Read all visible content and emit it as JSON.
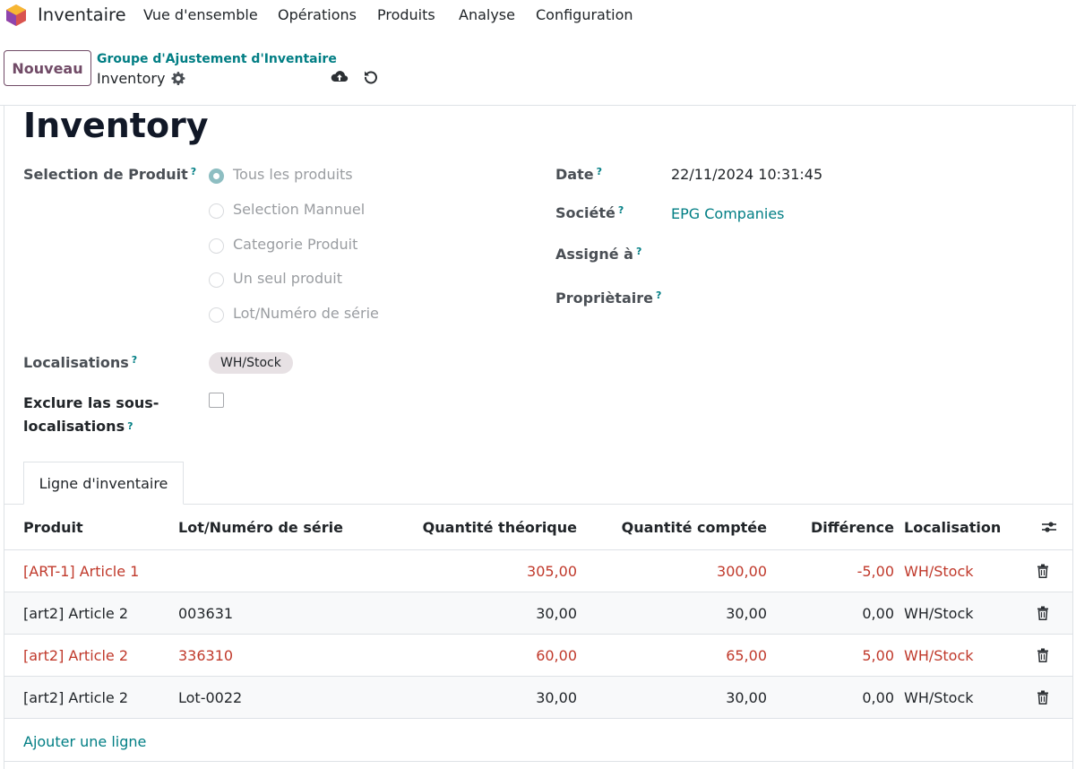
{
  "nav": {
    "app_name": "Inventaire",
    "menu": [
      "Vue d'ensemble",
      "Opérations",
      "Produits",
      "Analyse",
      "Configuration"
    ]
  },
  "control": {
    "new_button": "Nouveau",
    "breadcrumb_parent": "Groupe d'Ajustement d'Inventaire",
    "breadcrumb_current": "Inventory"
  },
  "form": {
    "title": "Inventory",
    "product_selection": {
      "label": "Selection de Produit",
      "help": "?",
      "options": [
        "Tous les produits",
        "Selection Mannuel",
        "Categorie Produit",
        "Un seul produit",
        "Lot/Numéro de série"
      ],
      "selected": "Tous les produits"
    },
    "date": {
      "label": "Date",
      "help": "?",
      "value": "22/11/2024 10:31:45"
    },
    "company": {
      "label": "Société",
      "help": "?",
      "value": "EPG Companies"
    },
    "assigned": {
      "label": "Assigné à",
      "help": "?",
      "value": ""
    },
    "owner": {
      "label": "Propriètaire",
      "help": "?",
      "value": ""
    },
    "locations": {
      "label": "Localisations",
      "help": "?",
      "tag": "WH/Stock"
    },
    "exclude": {
      "label_line1": "Exclure las sous-",
      "label_line2": "localisations",
      "help": "?",
      "checked": false
    }
  },
  "tabs": {
    "active": "Ligne d'inventaire"
  },
  "table": {
    "headers": {
      "product": "Produit",
      "lot": "Lot/Numéro de série",
      "theoretical": "Quantité théorique",
      "counted": "Quantité comptée",
      "difference": "Différence",
      "location": "Localisation"
    },
    "rows": [
      {
        "product": "[ART-1] Article 1",
        "lot": "",
        "theoretical": "305,00",
        "counted": "300,00",
        "difference": "-5,00",
        "location": "WH/Stock",
        "highlight": true
      },
      {
        "product": "[art2] Article 2",
        "lot": "003631",
        "theoretical": "30,00",
        "counted": "30,00",
        "difference": "0,00",
        "location": "WH/Stock",
        "highlight": false
      },
      {
        "product": "[art2] Article 2",
        "lot": "336310",
        "theoretical": "60,00",
        "counted": "65,00",
        "difference": "5,00",
        "location": "WH/Stock",
        "highlight": true
      },
      {
        "product": "[art2] Article 2",
        "lot": "Lot-0022",
        "theoretical": "30,00",
        "counted": "30,00",
        "difference": "0,00",
        "location": "WH/Stock",
        "highlight": false
      }
    ],
    "add_line": "Ajouter une ligne"
  },
  "colors": {
    "accent": "#017e84",
    "brand": "#714b67",
    "danger": "#c0392b"
  },
  "icons": [
    "app-logo-icon",
    "gear-icon",
    "cloud-upload-icon",
    "undo-icon",
    "column-settings-icon",
    "trash-icon"
  ]
}
